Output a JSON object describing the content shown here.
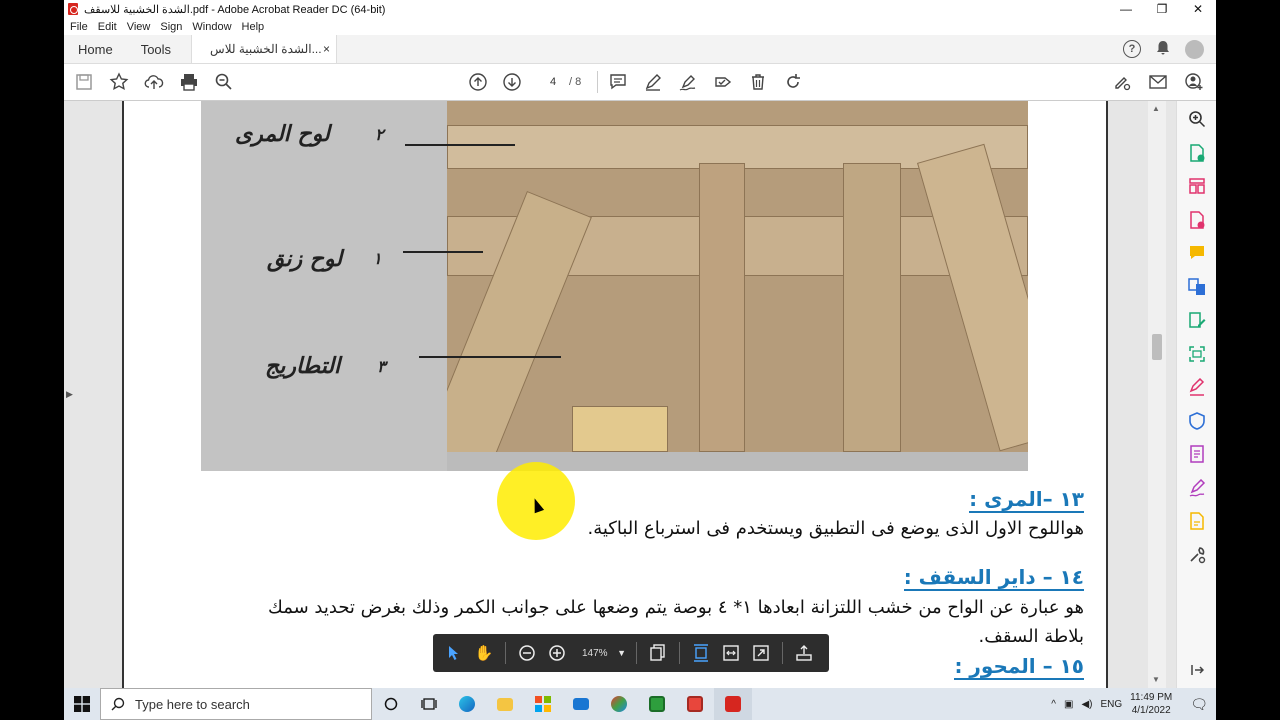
{
  "window": {
    "title": "الشدة الخشبية للاسقف.pdf - Adobe Acrobat Reader DC (64-bit)",
    "controls": {
      "minimize": "—",
      "restore": "❐",
      "close": "✕"
    }
  },
  "menu": [
    "File",
    "Edit",
    "View",
    "Sign",
    "Window",
    "Help"
  ],
  "tabs": {
    "home": "Home",
    "tools": "Tools",
    "document": "الشدة الخشبية للاس...",
    "close": "×"
  },
  "toolbar": {
    "page_current": "4",
    "page_separator": "/",
    "page_total": "8"
  },
  "photo_labels": {
    "label_1": "لوح المرى",
    "num_1": "٢",
    "label_2": "لوح زنق",
    "num_2": "١",
    "label_3": "التطاريج",
    "num_3": "٣"
  },
  "content": {
    "h13": "١٣ –المرى :",
    "p13": "هواللوح الاول الذى يوضع فى التطبيق ويستخدم فى استرباع الباكية.",
    "h14": "١٤ – داير السقف :",
    "p14_line1": "هو عبارة عن الواح من خشب اللتزانة ابعادها ١* ٤ بوصة يتم وضعها على جوانب الكمر وذلك بغرض تحديد سمك",
    "p14_line2": "بلاطة السقف.",
    "h15": "١٥ – المحور :"
  },
  "floating_toolbar": {
    "zoom": "147%"
  },
  "taskbar": {
    "search_placeholder": "Type here to search",
    "lang": "ENG",
    "time": "11:49 PM",
    "date": "4/1/2022"
  },
  "colors": {
    "heading_blue": "#1a78b8",
    "acrobat_red": "#d6261f",
    "highlight_yellow": "#ffec00"
  }
}
